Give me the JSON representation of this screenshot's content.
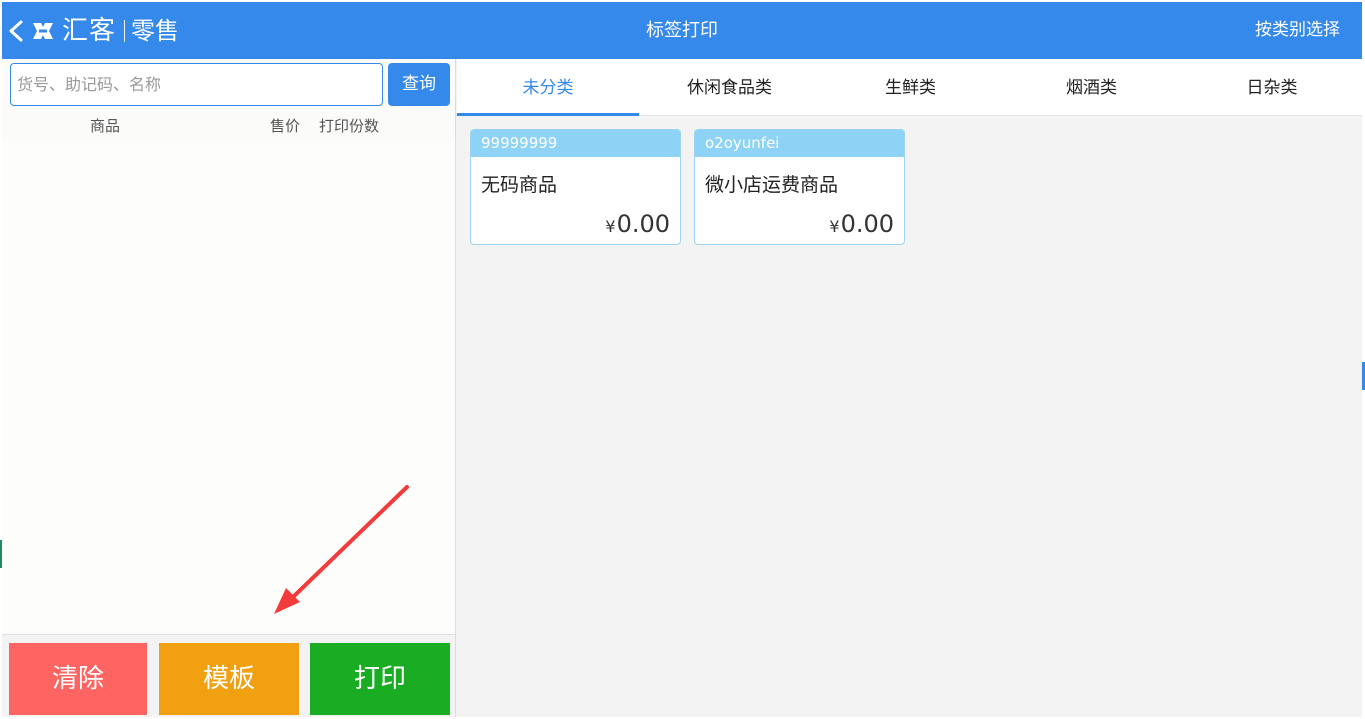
{
  "app": {
    "brand_name": "汇客",
    "brand_sub": "零售",
    "title": "标签打印",
    "category_select_label": "按类别选择"
  },
  "search": {
    "placeholder": "货号、助记码、名称",
    "value": "",
    "button_label": "查询"
  },
  "columns": {
    "product": "商品",
    "price": "售价",
    "copies": "打印份数"
  },
  "actions": {
    "clear": "清除",
    "template": "模板",
    "print": "打印"
  },
  "tabs": [
    {
      "label": "未分类",
      "active": true
    },
    {
      "label": "休闲食品类",
      "active": false
    },
    {
      "label": "生鲜类",
      "active": false
    },
    {
      "label": "烟酒类",
      "active": false
    },
    {
      "label": "日杂类",
      "active": false
    }
  ],
  "products": [
    {
      "code": "99999999",
      "name": "无码商品",
      "currency": "¥",
      "price": "0.00"
    },
    {
      "code": "o2oyunfei",
      "name": "微小店运费商品",
      "currency": "¥",
      "price": "0.00"
    }
  ],
  "colors": {
    "primary": "#3589ea",
    "clear_button": "#fd6462",
    "template_button": "#f0a010",
    "print_button": "#1aad24",
    "card_header": "#8ed2f6",
    "annotation_arrow": "#f33b3b"
  },
  "icons": {
    "back": "chevron-left-icon",
    "logo": "huike-logo-icon"
  }
}
